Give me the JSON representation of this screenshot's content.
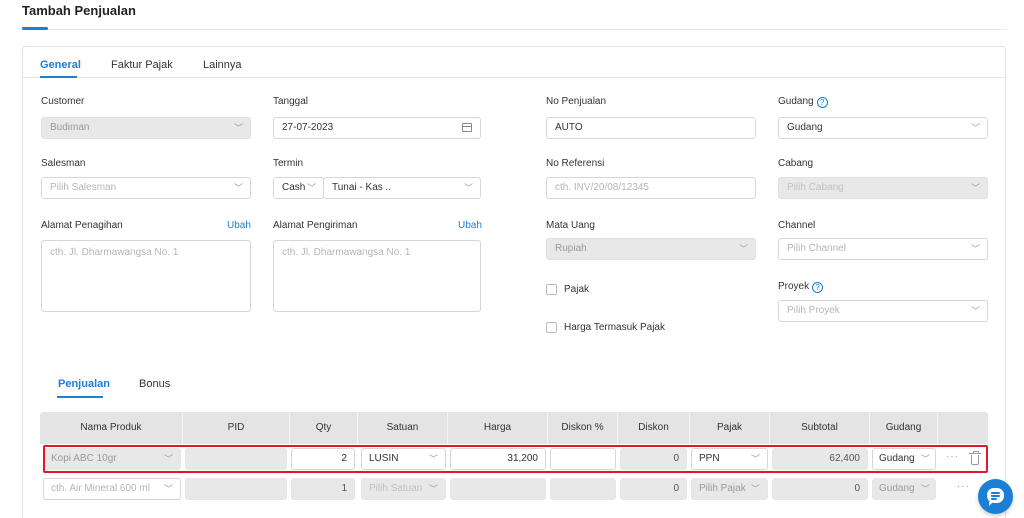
{
  "page": {
    "title": "Tambah Penjualan"
  },
  "tabs": [
    "General",
    "Faktur Pajak",
    "Lainnya"
  ],
  "form": {
    "customer": {
      "label": "Customer",
      "value": "Budiman"
    },
    "tanggal": {
      "label": "Tanggal",
      "value": "27-07-2023"
    },
    "no_penjualan": {
      "label": "No Penjualan",
      "value": "AUTO"
    },
    "gudang": {
      "label": "Gudang",
      "value": "Gudang"
    },
    "salesman": {
      "label": "Salesman",
      "placeholder": "Pilih Salesman"
    },
    "termin": {
      "label": "Termin",
      "type": "Cash",
      "account": "Tunai - Kas .."
    },
    "no_referensi": {
      "label": "No Referensi",
      "placeholder": "cth. INV/20/08/12345"
    },
    "cabang": {
      "label": "Cabang",
      "placeholder": "Pilih Cabang"
    },
    "alamat_penagihan": {
      "label": "Alamat Penagihan",
      "link": "Ubah",
      "placeholder": "cth. Jl. Dharmawangsa No. 1"
    },
    "alamat_pengiriman": {
      "label": "Alamat Pengiriman",
      "link": "Ubah",
      "placeholder": "cth. Jl. Dharmawangsa No. 1"
    },
    "mata_uang": {
      "label": "Mata Uang",
      "value": "Rupiah"
    },
    "channel": {
      "label": "Channel",
      "placeholder": "Pilih Channel"
    },
    "proyek": {
      "label": "Proyek",
      "placeholder": "Pilih Proyek"
    },
    "pajak": {
      "label": "Pajak"
    },
    "harga_termasuk_pajak": {
      "label": "Harga Termasuk Pajak"
    }
  },
  "subtabs": [
    "Penjualan",
    "Bonus"
  ],
  "table": {
    "columns": [
      "Nama Produk",
      "PID",
      "Qty",
      "Satuan",
      "Harga",
      "Diskon %",
      "Diskon",
      "Pajak",
      "Subtotal",
      "Gudang"
    ],
    "rows": [
      {
        "produk": "Kopi ABC 10gr",
        "pid": "",
        "qty": "2",
        "satuan": "LUSIN",
        "harga": "31,200",
        "diskon_pct": "",
        "diskon": "0",
        "pajak": "PPN",
        "subtotal": "62,400",
        "gudang": "Gudang"
      },
      {
        "produk": "cth. Air Mineral 600 ml",
        "pid": "",
        "qty": "1",
        "satuan": "Pilih Satuan",
        "harga": "",
        "diskon_pct": "",
        "diskon": "0",
        "pajak": "Pilih Pajak",
        "subtotal": "0",
        "gudang": "Gudang"
      }
    ]
  },
  "icons": {
    "chevron": "chevron-down-icon",
    "calendar": "calendar-icon",
    "help": "help-circle-icon",
    "more": "more-horizontal-icon",
    "trash": "trash-icon",
    "chat": "chat-icon"
  },
  "colors": {
    "accent": "#1b7fd6",
    "highlight": "#e0182d"
  }
}
